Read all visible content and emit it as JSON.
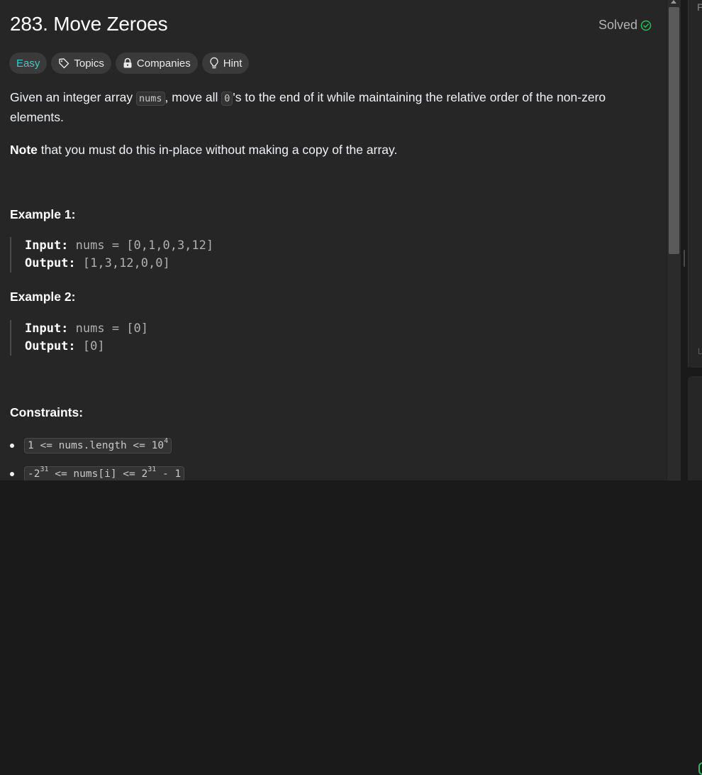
{
  "problem": {
    "title": "283. Move Zeroes",
    "status": "Solved"
  },
  "tags": {
    "difficulty": "Easy",
    "topics": "Topics",
    "companies": "Companies",
    "hint": "Hint"
  },
  "description": {
    "p1_a": "Given an integer array ",
    "p1_code1": "nums",
    "p1_b": ", move all ",
    "p1_code2": "0",
    "p1_c": "'s to the end of it while maintaining the relative order of the non-zero elements.",
    "note_bold": "Note",
    "note_rest": " that you must do this in-place without making a copy of the array."
  },
  "examples": [
    {
      "title": "Example 1:",
      "input_label": "Input:",
      "input_value": " nums = [0,1,0,3,12]",
      "output_label": "Output:",
      "output_value": " [1,3,12,0,0]"
    },
    {
      "title": "Example 2:",
      "input_label": "Input:",
      "input_value": " nums = [0]",
      "output_label": "Output:",
      "output_value": " [0]"
    }
  ],
  "constraints": {
    "title": "Constraints:",
    "c1_pre": "1 <= nums.length <= 10",
    "c1_sup": "4",
    "c2_a": "-2",
    "c2_sup1": "31",
    "c2_b": " <= nums[i] <= 2",
    "c2_sup2": "31",
    "c2_c": " - 1"
  },
  "right_panel": {
    "top_char": "P",
    "mid_char": "L"
  },
  "colors": {
    "easy": "#46c6c2",
    "solved_check": "#2cbb5d",
    "panel_bg": "#262626"
  },
  "icons": [
    "check-circle-icon",
    "tag-icon",
    "lock-icon",
    "lightbulb-icon"
  ]
}
